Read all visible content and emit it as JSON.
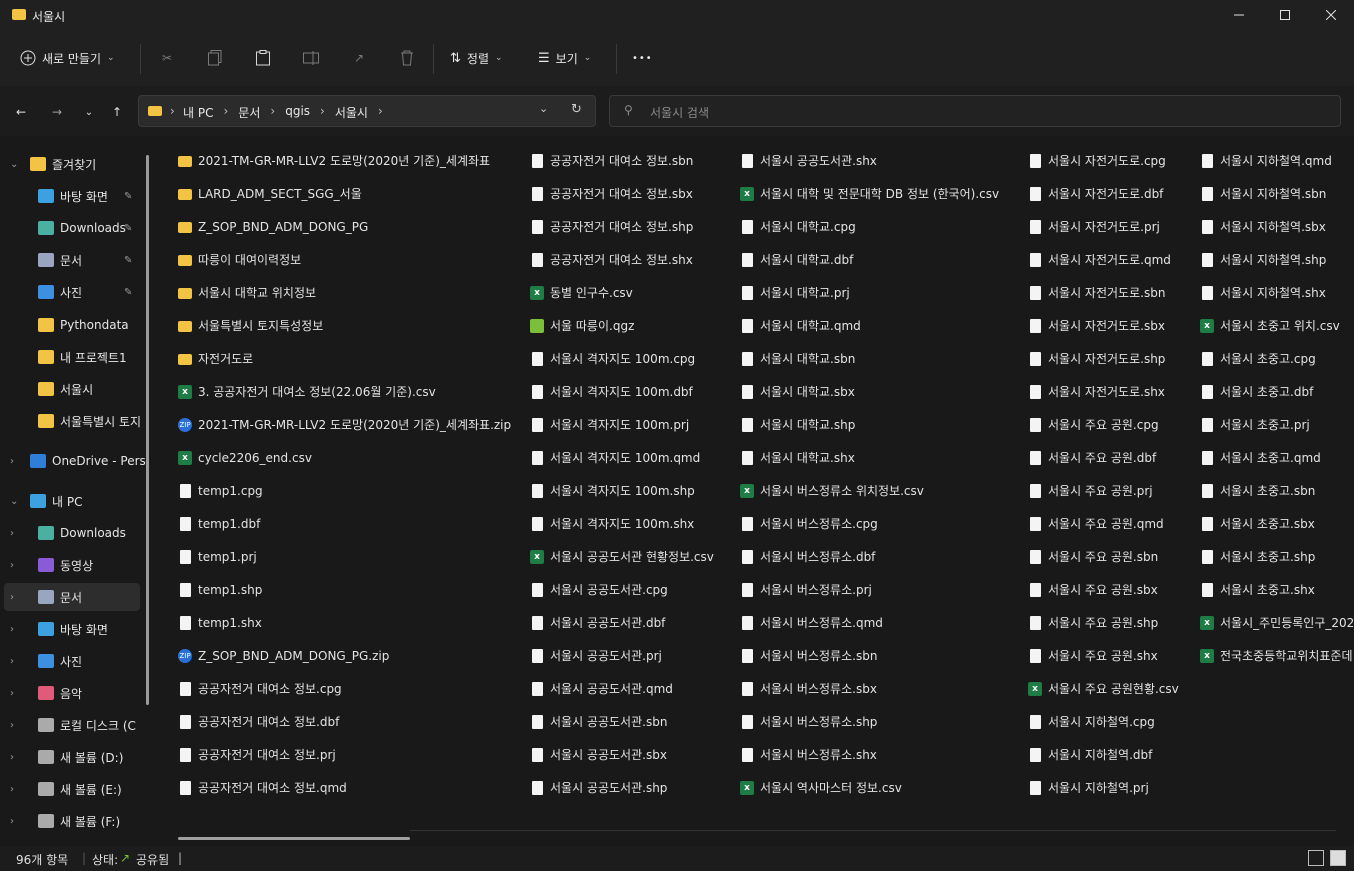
{
  "window": {
    "title": "서울시"
  },
  "toolbar": {
    "new_label": "새로 만들기",
    "sort_label": "정렬",
    "view_label": "보기",
    "more_label": "•••"
  },
  "address": {
    "crumbs": [
      "내 PC",
      "문서",
      "qgis",
      "서울시"
    ]
  },
  "search": {
    "placeholder": "서울시 검색"
  },
  "sidebar": {
    "items": [
      {
        "label": "즐겨찾기",
        "icon": "star-icon",
        "pinned": false
      },
      {
        "label": "바탕 화면",
        "icon": "desktop-icon",
        "pinned": true
      },
      {
        "label": "Downloads",
        "icon": "download-icon",
        "pinned": true
      },
      {
        "label": "문서",
        "icon": "document-icon",
        "pinned": true
      },
      {
        "label": "사진",
        "icon": "pictures-icon",
        "pinned": true
      },
      {
        "label": "Pythondata",
        "icon": "folder-icon",
        "pinned": false
      },
      {
        "label": "내 프로젝트1",
        "icon": "folder-icon",
        "pinned": false
      },
      {
        "label": "서울시",
        "icon": "folder-icon",
        "pinned": false
      },
      {
        "label": "서울특별시 토지",
        "icon": "folder-icon",
        "pinned": false
      },
      {
        "label": "OneDrive - Perso",
        "icon": "cloud-icon",
        "pinned": false
      },
      {
        "label": "내 PC",
        "icon": "pc-icon",
        "pinned": false
      },
      {
        "label": "Downloads",
        "icon": "download-icon",
        "pinned": false
      },
      {
        "label": "동영상",
        "icon": "video-icon",
        "pinned": false
      },
      {
        "label": "문서",
        "icon": "document-icon",
        "pinned": false
      },
      {
        "label": "바탕 화면",
        "icon": "desktop-icon",
        "pinned": false
      },
      {
        "label": "사진",
        "icon": "pictures-icon",
        "pinned": false
      },
      {
        "label": "음악",
        "icon": "music-icon",
        "pinned": false
      },
      {
        "label": "로컬 디스크 (C",
        "icon": "drive-icon",
        "pinned": false
      },
      {
        "label": "새 볼륨 (D:)",
        "icon": "drive-icon",
        "pinned": false
      },
      {
        "label": "새 볼륨 (E:)",
        "icon": "drive-icon",
        "pinned": false
      },
      {
        "label": "새 볼륨 (F:)",
        "icon": "drive-icon",
        "pinned": false
      }
    ]
  },
  "files": {
    "columns": [
      [
        {
          "name": "2021-TM-GR-MR-LLV2 도로망(2020년 기준)_세계좌표",
          "type": "folder"
        },
        {
          "name": "LARD_ADM_SECT_SGG_서울",
          "type": "folder"
        },
        {
          "name": "Z_SOP_BND_ADM_DONG_PG",
          "type": "folder"
        },
        {
          "name": "따릉이 대여이력정보",
          "type": "folder"
        },
        {
          "name": "서울시 대학교 위치정보",
          "type": "folder"
        },
        {
          "name": "서울특별시 토지특성정보",
          "type": "folder"
        },
        {
          "name": "자전거도로",
          "type": "folder"
        },
        {
          "name": "3. 공공자전거 대여소 정보(22.06월 기준).csv",
          "type": "csv"
        },
        {
          "name": "2021-TM-GR-MR-LLV2 도로망(2020년 기준)_세계좌표.zip",
          "type": "zip"
        },
        {
          "name": "cycle2206_end.csv",
          "type": "csv"
        },
        {
          "name": "temp1.cpg",
          "type": "file"
        },
        {
          "name": "temp1.dbf",
          "type": "file"
        },
        {
          "name": "temp1.prj",
          "type": "file"
        },
        {
          "name": "temp1.shp",
          "type": "file"
        },
        {
          "name": "temp1.shx",
          "type": "file"
        },
        {
          "name": "Z_SOP_BND_ADM_DONG_PG.zip",
          "type": "zip"
        },
        {
          "name": "공공자전거 대여소 정보.cpg",
          "type": "file"
        },
        {
          "name": "공공자전거 대여소 정보.dbf",
          "type": "file"
        },
        {
          "name": "공공자전거 대여소 정보.prj",
          "type": "file"
        },
        {
          "name": "공공자전거 대여소 정보.qmd",
          "type": "file"
        }
      ],
      [
        {
          "name": "공공자전거 대여소 정보.sbn",
          "type": "file"
        },
        {
          "name": "공공자전거 대여소 정보.sbx",
          "type": "file"
        },
        {
          "name": "공공자전거 대여소 정보.shp",
          "type": "file"
        },
        {
          "name": "공공자전거 대여소 정보.shx",
          "type": "file"
        },
        {
          "name": "동별 인구수.csv",
          "type": "csv"
        },
        {
          "name": "서울 따릉이.qgz",
          "type": "qgz"
        },
        {
          "name": "서울시 격자지도 100m.cpg",
          "type": "file"
        },
        {
          "name": "서울시 격자지도 100m.dbf",
          "type": "file"
        },
        {
          "name": "서울시 격자지도 100m.prj",
          "type": "file"
        },
        {
          "name": "서울시 격자지도 100m.qmd",
          "type": "file"
        },
        {
          "name": "서울시 격자지도 100m.shp",
          "type": "file"
        },
        {
          "name": "서울시 격자지도 100m.shx",
          "type": "file"
        },
        {
          "name": "서울시 공공도서관 현황정보.csv",
          "type": "csv"
        },
        {
          "name": "서울시 공공도서관.cpg",
          "type": "file"
        },
        {
          "name": "서울시 공공도서관.dbf",
          "type": "file"
        },
        {
          "name": "서울시 공공도서관.prj",
          "type": "file"
        },
        {
          "name": "서울시 공공도서관.qmd",
          "type": "file"
        },
        {
          "name": "서울시 공공도서관.sbn",
          "type": "file"
        },
        {
          "name": "서울시 공공도서관.sbx",
          "type": "file"
        },
        {
          "name": "서울시 공공도서관.shp",
          "type": "file"
        }
      ],
      [
        {
          "name": "서울시 공공도서관.shx",
          "type": "file"
        },
        {
          "name": "서울시 대학 및 전문대학 DB 정보 (한국어).csv",
          "type": "csv"
        },
        {
          "name": "서울시 대학교.cpg",
          "type": "file"
        },
        {
          "name": "서울시 대학교.dbf",
          "type": "file"
        },
        {
          "name": "서울시 대학교.prj",
          "type": "file"
        },
        {
          "name": "서울시 대학교.qmd",
          "type": "file"
        },
        {
          "name": "서울시 대학교.sbn",
          "type": "file"
        },
        {
          "name": "서울시 대학교.sbx",
          "type": "file"
        },
        {
          "name": "서울시 대학교.shp",
          "type": "file"
        },
        {
          "name": "서울시 대학교.shx",
          "type": "file"
        },
        {
          "name": "서울시 버스정류소 위치정보.csv",
          "type": "csv"
        },
        {
          "name": "서울시 버스정류소.cpg",
          "type": "file"
        },
        {
          "name": "서울시 버스정류소.dbf",
          "type": "file"
        },
        {
          "name": "서울시 버스정류소.prj",
          "type": "file"
        },
        {
          "name": "서울시 버스정류소.qmd",
          "type": "file"
        },
        {
          "name": "서울시 버스정류소.sbn",
          "type": "file"
        },
        {
          "name": "서울시 버스정류소.sbx",
          "type": "file"
        },
        {
          "name": "서울시 버스정류소.shp",
          "type": "file"
        },
        {
          "name": "서울시 버스정류소.shx",
          "type": "file"
        },
        {
          "name": "서울시 역사마스터 정보.csv",
          "type": "csv"
        }
      ],
      [
        {
          "name": "서울시 자전거도로.cpg",
          "type": "file"
        },
        {
          "name": "서울시 자전거도로.dbf",
          "type": "file"
        },
        {
          "name": "서울시 자전거도로.prj",
          "type": "file"
        },
        {
          "name": "서울시 자전거도로.qmd",
          "type": "file"
        },
        {
          "name": "서울시 자전거도로.sbn",
          "type": "file"
        },
        {
          "name": "서울시 자전거도로.sbx",
          "type": "file"
        },
        {
          "name": "서울시 자전거도로.shp",
          "type": "file"
        },
        {
          "name": "서울시 자전거도로.shx",
          "type": "file"
        },
        {
          "name": "서울시 주요 공원.cpg",
          "type": "file"
        },
        {
          "name": "서울시 주요 공원.dbf",
          "type": "file"
        },
        {
          "name": "서울시 주요 공원.prj",
          "type": "file"
        },
        {
          "name": "서울시 주요 공원.qmd",
          "type": "file"
        },
        {
          "name": "서울시 주요 공원.sbn",
          "type": "file"
        },
        {
          "name": "서울시 주요 공원.sbx",
          "type": "file"
        },
        {
          "name": "서울시 주요 공원.shp",
          "type": "file"
        },
        {
          "name": "서울시 주요 공원.shx",
          "type": "file"
        },
        {
          "name": "서울시 주요 공원현황.csv",
          "type": "csv"
        },
        {
          "name": "서울시 지하철역.cpg",
          "type": "file"
        },
        {
          "name": "서울시 지하철역.dbf",
          "type": "file"
        },
        {
          "name": "서울시 지하철역.prj",
          "type": "file"
        }
      ],
      [
        {
          "name": "서울시 지하철역.qmd",
          "type": "file"
        },
        {
          "name": "서울시 지하철역.sbn",
          "type": "file"
        },
        {
          "name": "서울시 지하철역.sbx",
          "type": "file"
        },
        {
          "name": "서울시 지하철역.shp",
          "type": "file"
        },
        {
          "name": "서울시 지하철역.shx",
          "type": "file"
        },
        {
          "name": "서울시 초중고 위치.csv",
          "type": "csv"
        },
        {
          "name": "서울시 초중고.cpg",
          "type": "file"
        },
        {
          "name": "서울시 초중고.dbf",
          "type": "file"
        },
        {
          "name": "서울시 초중고.prj",
          "type": "file"
        },
        {
          "name": "서울시 초중고.qmd",
          "type": "file"
        },
        {
          "name": "서울시 초중고.sbn",
          "type": "file"
        },
        {
          "name": "서울시 초중고.sbx",
          "type": "file"
        },
        {
          "name": "서울시 초중고.shp",
          "type": "file"
        },
        {
          "name": "서울시 초중고.shx",
          "type": "file"
        },
        {
          "name": "서울시_주민등록인구_202",
          "type": "csv"
        },
        {
          "name": "전국초중등학교위치표준데",
          "type": "csv"
        }
      ]
    ]
  },
  "status": {
    "count": "96개 항목",
    "state_label": "상태:",
    "state_value": "공유됨"
  }
}
